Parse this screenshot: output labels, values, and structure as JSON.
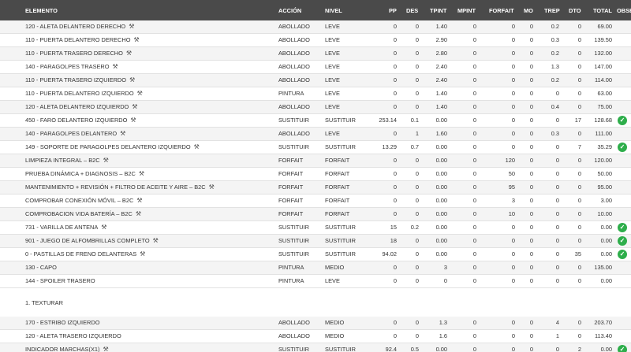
{
  "headers": {
    "elemento": "ELEMENTO",
    "accion": "ACCIÓN",
    "nivel": "NIVEL",
    "pp": "PP",
    "des": "DES",
    "tpint": "TPINT",
    "mpint": "MPINT",
    "forfait": "FORFAIT",
    "mo": "MO",
    "trep": "TREP",
    "dto": "DTO",
    "total": "TOTAL",
    "obse": "OBSE"
  },
  "rows": [
    {
      "elemento": "120 - ALETA DELANTERO DERECHO",
      "accion": "ABOLLADO",
      "nivel": "LEVE",
      "pp": "0",
      "des": "0",
      "tpint": "1.40",
      "mpint": "0",
      "forfait": "0",
      "mo": "0",
      "trep": "0.2",
      "dto": "0",
      "total": "69.00",
      "wrench": true,
      "check": false
    },
    {
      "elemento": "110 - PUERTA DELANTERO DERECHO",
      "accion": "ABOLLADO",
      "nivel": "LEVE",
      "pp": "0",
      "des": "0",
      "tpint": "2.90",
      "mpint": "0",
      "forfait": "0",
      "mo": "0",
      "trep": "0.3",
      "dto": "0",
      "total": "139.50",
      "wrench": true,
      "check": false
    },
    {
      "elemento": "110 - PUERTA TRASERO DERECHO",
      "accion": "ABOLLADO",
      "nivel": "LEVE",
      "pp": "0",
      "des": "0",
      "tpint": "2.80",
      "mpint": "0",
      "forfait": "0",
      "mo": "0",
      "trep": "0.2",
      "dto": "0",
      "total": "132.00",
      "wrench": true,
      "check": false
    },
    {
      "elemento": "140 - PARAGOLPES TRASERO",
      "accion": "ABOLLADO",
      "nivel": "LEVE",
      "pp": "0",
      "des": "0",
      "tpint": "2.40",
      "mpint": "0",
      "forfait": "0",
      "mo": "0",
      "trep": "1.3",
      "dto": "0",
      "total": "147.00",
      "wrench": true,
      "check": false
    },
    {
      "elemento": "110 - PUERTA TRASERO IZQUIERDO",
      "accion": "ABOLLADO",
      "nivel": "LEVE",
      "pp": "0",
      "des": "0",
      "tpint": "2.40",
      "mpint": "0",
      "forfait": "0",
      "mo": "0",
      "trep": "0.2",
      "dto": "0",
      "total": "114.00",
      "wrench": true,
      "check": false
    },
    {
      "elemento": "110 - PUERTA DELANTERO IZQUIERDO",
      "accion": "PINTURA",
      "nivel": "LEVE",
      "pp": "0",
      "des": "0",
      "tpint": "1.40",
      "mpint": "0",
      "forfait": "0",
      "mo": "0",
      "trep": "0",
      "dto": "0",
      "total": "63.00",
      "wrench": true,
      "check": false
    },
    {
      "elemento": "120 - ALETA DELANTERO IZQUIERDO",
      "accion": "ABOLLADO",
      "nivel": "LEVE",
      "pp": "0",
      "des": "0",
      "tpint": "1.40",
      "mpint": "0",
      "forfait": "0",
      "mo": "0",
      "trep": "0.4",
      "dto": "0",
      "total": "75.00",
      "wrench": true,
      "check": false
    },
    {
      "elemento": "450 - FARO DELANTERO IZQUIERDO",
      "accion": "SUSTITUIR",
      "nivel": "SUSTITUIR",
      "pp": "253.14",
      "des": "0.1",
      "tpint": "0.00",
      "mpint": "0",
      "forfait": "0",
      "mo": "0",
      "trep": "0",
      "dto": "17",
      "total": "128.68",
      "wrench": true,
      "check": true
    },
    {
      "elemento": "140 - PARAGOLPES DELANTERO",
      "accion": "ABOLLADO",
      "nivel": "LEVE",
      "pp": "0",
      "des": "1",
      "tpint": "1.60",
      "mpint": "0",
      "forfait": "0",
      "mo": "0",
      "trep": "0.3",
      "dto": "0",
      "total": "111.00",
      "wrench": true,
      "check": false
    },
    {
      "elemento": "149 - SOPORTE DE PARAGOLPES DELANTERO IZQUIERDO",
      "accion": "SUSTITUIR",
      "nivel": "SUSTITUIR",
      "pp": "13.29",
      "des": "0.7",
      "tpint": "0.00",
      "mpint": "0",
      "forfait": "0",
      "mo": "0",
      "trep": "0",
      "dto": "7",
      "total": "35.29",
      "wrench": true,
      "check": true
    },
    {
      "elemento": "LIMPIEZA INTEGRAL – B2C",
      "accion": "FORFAIT",
      "nivel": "FORFAIT",
      "pp": "0",
      "des": "0",
      "tpint": "0.00",
      "mpint": "0",
      "forfait": "120",
      "mo": "0",
      "trep": "0",
      "dto": "0",
      "total": "120.00",
      "wrench": true,
      "check": false
    },
    {
      "elemento": "PRUEBA DINÁMICA + DIAGNOSIS – B2C",
      "accion": "FORFAIT",
      "nivel": "FORFAIT",
      "pp": "0",
      "des": "0",
      "tpint": "0.00",
      "mpint": "0",
      "forfait": "50",
      "mo": "0",
      "trep": "0",
      "dto": "0",
      "total": "50.00",
      "wrench": true,
      "check": false
    },
    {
      "elemento": "MANTENIMIENTO + REVISIÓN + FILTRO DE ACEITE Y AIRE – B2C",
      "accion": "FORFAIT",
      "nivel": "FORFAIT",
      "pp": "0",
      "des": "0",
      "tpint": "0.00",
      "mpint": "0",
      "forfait": "95",
      "mo": "0",
      "trep": "0",
      "dto": "0",
      "total": "95.00",
      "wrench": true,
      "check": false
    },
    {
      "elemento": "COMPROBAR CONEXIÓN MÓVIL – B2C",
      "accion": "FORFAIT",
      "nivel": "FORFAIT",
      "pp": "0",
      "des": "0",
      "tpint": "0.00",
      "mpint": "0",
      "forfait": "3",
      "mo": "0",
      "trep": "0",
      "dto": "0",
      "total": "3.00",
      "wrench": true,
      "check": false
    },
    {
      "elemento": "COMPROBACION VIDA BATERÍA – B2C",
      "accion": "FORFAIT",
      "nivel": "FORFAIT",
      "pp": "0",
      "des": "0",
      "tpint": "0.00",
      "mpint": "0",
      "forfait": "10",
      "mo": "0",
      "trep": "0",
      "dto": "0",
      "total": "10.00",
      "wrench": true,
      "check": false
    },
    {
      "elemento": "731 - VARILLA DE ANTENA",
      "accion": "SUSTITUIR",
      "nivel": "SUSTITUIR",
      "pp": "15",
      "des": "0.2",
      "tpint": "0.00",
      "mpint": "0",
      "forfait": "0",
      "mo": "0",
      "trep": "0",
      "dto": "0",
      "total": "0.00",
      "wrench": true,
      "check": true
    },
    {
      "elemento": "901 - JUEGO DE ALFOMBRILLAS COMPLETO",
      "accion": "SUSTITUIR",
      "nivel": "SUSTITUIR",
      "pp": "18",
      "des": "0",
      "tpint": "0.00",
      "mpint": "0",
      "forfait": "0",
      "mo": "0",
      "trep": "0",
      "dto": "0",
      "total": "0.00",
      "wrench": true,
      "check": true
    },
    {
      "elemento": "0 - PASTILLAS DE FRENO DELANTERAS",
      "accion": "SUSTITUIR",
      "nivel": "SUSTITUIR",
      "pp": "94.02",
      "des": "0",
      "tpint": "0.00",
      "mpint": "0",
      "forfait": "0",
      "mo": "0",
      "trep": "0",
      "dto": "35",
      "total": "0.00",
      "wrench": true,
      "check": true
    },
    {
      "elemento": "130 - CAPO",
      "accion": "PINTURA",
      "nivel": "MEDIO",
      "pp": "0",
      "des": "0",
      "tpint": "3",
      "mpint": "0",
      "forfait": "0",
      "mo": "0",
      "trep": "0",
      "dto": "0",
      "total": "135.00",
      "wrench": false,
      "check": false
    },
    {
      "elemento": "144 - SPOILER TRASERO",
      "accion": "PINTURA",
      "nivel": "LEVE",
      "pp": "0",
      "des": "0",
      "tpint": "0",
      "mpint": "0",
      "forfait": "0",
      "mo": "0",
      "trep": "0",
      "dto": "0",
      "total": "0.00",
      "wrench": false,
      "check": false
    },
    {
      "section": "1. TEXTURAR"
    },
    {
      "elemento": "170 - ESTRIBO IZQUIERDO",
      "accion": "ABOLLADO",
      "nivel": "MEDIO",
      "pp": "0",
      "des": "0",
      "tpint": "1.3",
      "mpint": "0",
      "forfait": "0",
      "mo": "0",
      "trep": "4",
      "dto": "0",
      "total": "203.70",
      "wrench": false,
      "check": false
    },
    {
      "elemento": "120 - ALETA TRASERO IZQUIERDO",
      "accion": "ABOLLADO",
      "nivel": "MEDIO",
      "pp": "0",
      "des": "0",
      "tpint": "1.6",
      "mpint": "0",
      "forfait": "0",
      "mo": "0",
      "trep": "1",
      "dto": "0",
      "total": "113.40",
      "wrench": false,
      "check": false
    },
    {
      "elemento": "INDICADOR MARCHAS(X1)",
      "accion": "SUSTITUIR",
      "nivel": "SUSTITUIR",
      "pp": "92.4",
      "des": "0.5",
      "tpint": "0.00",
      "mpint": "0",
      "forfait": "0",
      "mo": "0",
      "trep": "0",
      "dto": "2",
      "total": "0.00",
      "wrench": true,
      "check": true
    }
  ]
}
